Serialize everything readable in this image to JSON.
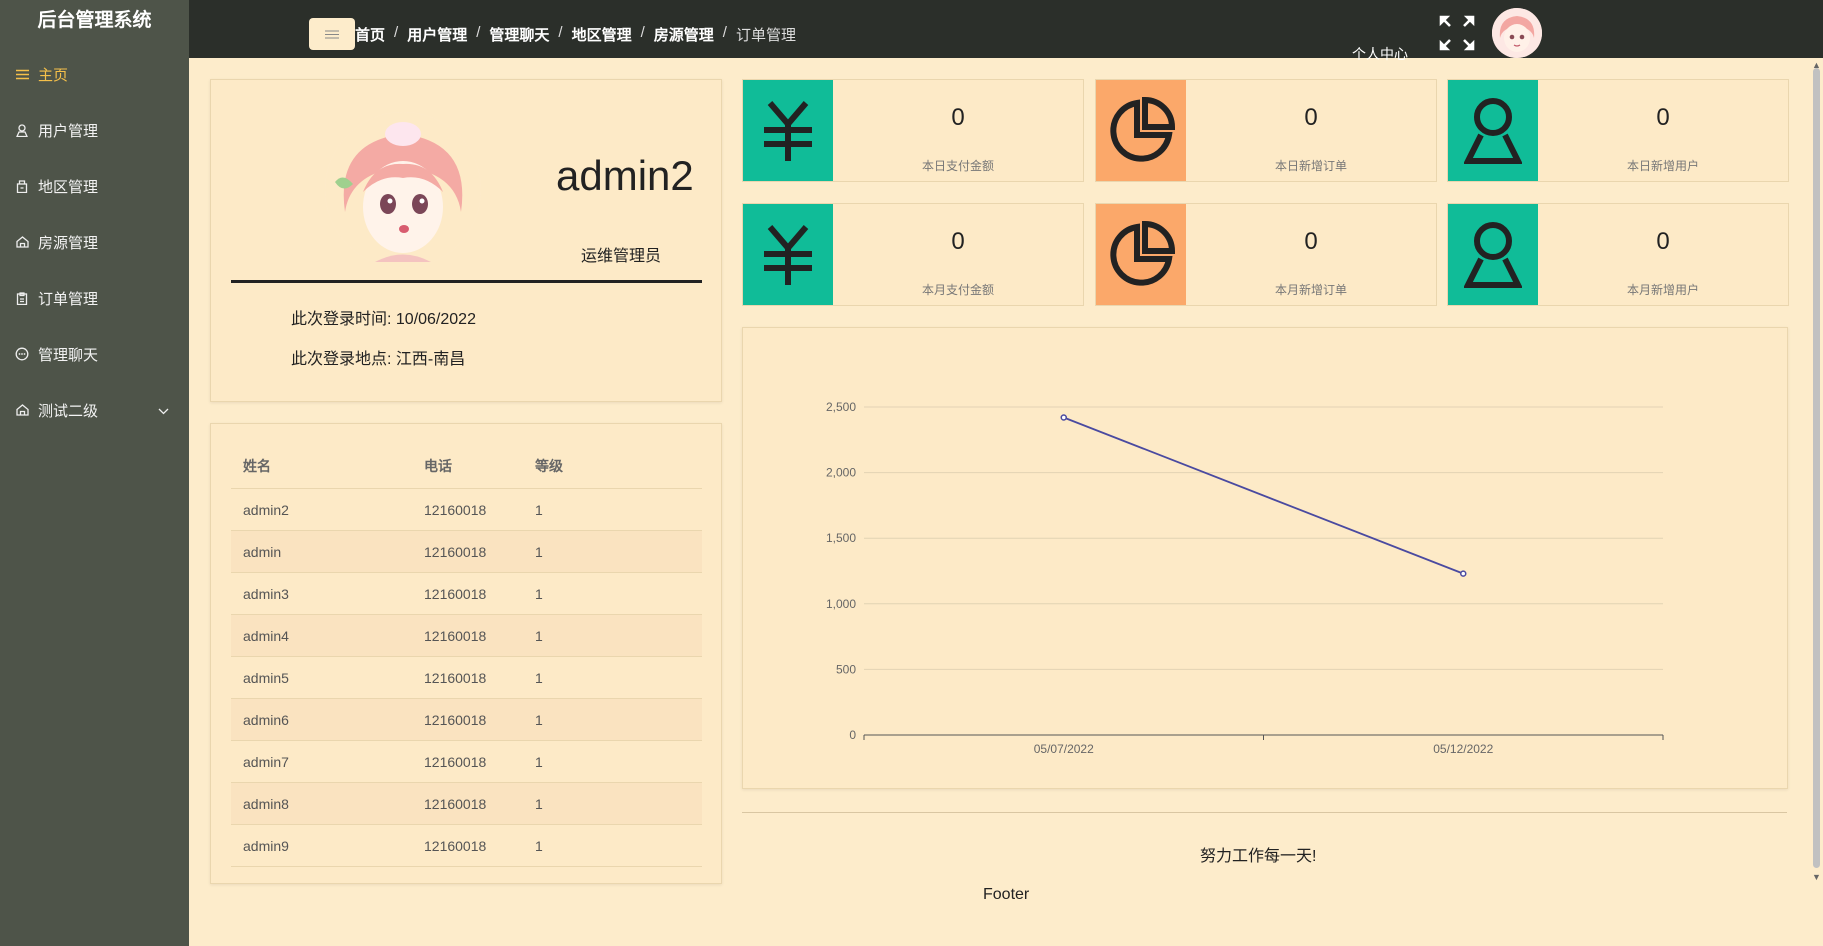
{
  "brand": "后台管理系统",
  "sidebar": {
    "items": [
      {
        "label": "主页",
        "icon": "menu-lines-icon",
        "active": true
      },
      {
        "label": "用户管理",
        "icon": "user-icon"
      },
      {
        "label": "地区管理",
        "icon": "building-icon"
      },
      {
        "label": "房源管理",
        "icon": "home-icon"
      },
      {
        "label": "订单管理",
        "icon": "clipboard-icon"
      },
      {
        "label": "管理聊天",
        "icon": "chat-icon"
      },
      {
        "label": "测试二级",
        "icon": "home-icon",
        "expandable": true
      }
    ]
  },
  "header": {
    "breadcrumbs": [
      "首页",
      "用户管理",
      "管理聊天",
      "地区管理",
      "房源管理",
      "订单管理"
    ],
    "separator": "/",
    "user_center": "个人中心"
  },
  "profile": {
    "username": "admin2",
    "role": "运维管理员",
    "login_time": "此次登录时间: 10/06/2022",
    "login_location": "此次登录地点: 江西-南昌"
  },
  "user_table": {
    "columns": [
      "姓名",
      "电话",
      "等级"
    ],
    "rows": [
      [
        "admin2",
        "12160018",
        "1"
      ],
      [
        "admin",
        "12160018",
        "1"
      ],
      [
        "admin3",
        "12160018",
        "1"
      ],
      [
        "admin4",
        "12160018",
        "1"
      ],
      [
        "admin5",
        "12160018",
        "1"
      ],
      [
        "admin6",
        "12160018",
        "1"
      ],
      [
        "admin7",
        "12160018",
        "1"
      ],
      [
        "admin8",
        "12160018",
        "1"
      ],
      [
        "admin9",
        "12160018",
        "1"
      ]
    ]
  },
  "stats": [
    {
      "value": "0",
      "label": "本日支付金额",
      "icon": "yuan-icon",
      "color": "#10bc98"
    },
    {
      "value": "0",
      "label": "本日新增订单",
      "icon": "pie-chart-icon",
      "color": "#fba86a"
    },
    {
      "value": "0",
      "label": "本日新增用户",
      "icon": "user-icon",
      "color": "#10bc98"
    },
    {
      "value": "0",
      "label": "本月支付金额",
      "icon": "yuan-icon",
      "color": "#10bc98"
    },
    {
      "value": "0",
      "label": "本月新增订单",
      "icon": "pie-chart-icon",
      "color": "#fba86a"
    },
    {
      "value": "0",
      "label": "本月新增用户",
      "icon": "user-icon",
      "color": "#10bc98"
    }
  ],
  "chart_data": {
    "type": "line",
    "x": [
      "05/07/2022",
      "05/12/2022"
    ],
    "series": [
      {
        "values": [
          2420,
          1230
        ],
        "color": "#4a4aa0"
      }
    ],
    "yticks": [
      "0",
      "500",
      "1,000",
      "1,500",
      "2,000",
      "2,500"
    ],
    "ylim": [
      0,
      2500
    ],
    "grid": true,
    "title": "",
    "xlabel": "",
    "ylabel": ""
  },
  "footer": {
    "slogan": "努力工作每一天!",
    "text": "Footer"
  }
}
